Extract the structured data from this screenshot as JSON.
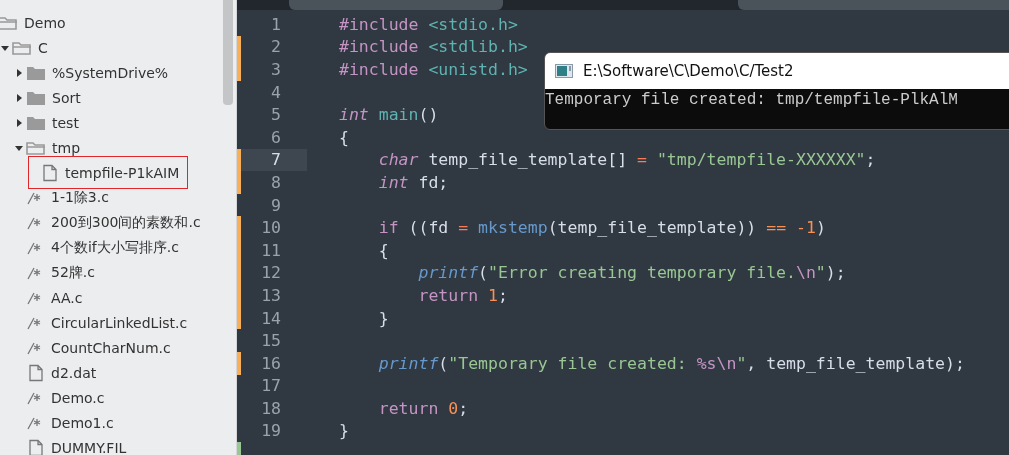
{
  "sidebar": {
    "tree": [
      {
        "name": "Demo",
        "kind": "folder",
        "expanded": true,
        "children": [
          {
            "name": "C",
            "kind": "folder",
            "expanded": true,
            "children": [
              {
                "name": "%SystemDrive%",
                "kind": "folder",
                "expanded": false
              },
              {
                "name": "Sort",
                "kind": "folder",
                "expanded": false
              },
              {
                "name": "test",
                "kind": "folder",
                "expanded": false
              },
              {
                "name": "tmp",
                "kind": "folder",
                "expanded": true,
                "children": [
                  {
                    "name": "tempfile-P1kAIM",
                    "kind": "file",
                    "highlighted": true
                  }
                ]
              },
              {
                "name": "1-1除3.c",
                "kind": "source",
                "highlighted": false
              },
              {
                "name": "200到300间的素数和.c",
                "kind": "source",
                "highlighted": false
              },
              {
                "name": "4个数if大小写排序.c",
                "kind": "source",
                "highlighted": false
              },
              {
                "name": "52牌.c",
                "kind": "source",
                "highlighted": false
              },
              {
                "name": "AA.c",
                "kind": "source",
                "highlighted": false
              },
              {
                "name": "CircularLinkedList.c",
                "kind": "source",
                "highlighted": false
              },
              {
                "name": "CountCharNum.c",
                "kind": "source",
                "highlighted": false
              },
              {
                "name": "d2.dat",
                "kind": "file",
                "highlighted": false
              },
              {
                "name": "Demo.c",
                "kind": "source",
                "highlighted": false
              },
              {
                "name": "Demo1.c",
                "kind": "source",
                "highlighted": false
              },
              {
                "name": "DUMMY.FIL",
                "kind": "file",
                "highlighted": false
              }
            ]
          }
        ]
      }
    ]
  },
  "editor": {
    "lines": [
      {
        "number": "1",
        "kind": "unchanged",
        "current": false,
        "tokens": [
          {
            "kind": "pp",
            "text": "#include"
          },
          {
            "kind": "hdr",
            "text": " <stdio.h>"
          }
        ]
      },
      {
        "number": "2",
        "kind": "modified",
        "current": false,
        "tokens": [
          {
            "kind": "pp",
            "text": "#include"
          },
          {
            "kind": "hdr",
            "text": " <stdlib.h>"
          }
        ]
      },
      {
        "number": "3",
        "kind": "modified",
        "current": false,
        "tokens": [
          {
            "kind": "pp",
            "text": "#include"
          },
          {
            "kind": "hdr",
            "text": " <unistd.h>"
          }
        ]
      },
      {
        "number": "4",
        "kind": "unchanged",
        "current": false
      },
      {
        "number": "5",
        "kind": "unchanged",
        "current": false,
        "tokens": [
          {
            "kind": "type",
            "text": "int"
          },
          {
            "kind": "main",
            "text": " main"
          },
          {
            "kind": "plain",
            "text": "()"
          }
        ]
      },
      {
        "number": "6",
        "kind": "unchanged",
        "current": false,
        "tokens": [
          {
            "kind": "plain",
            "text": "{"
          }
        ]
      },
      {
        "number": "7",
        "kind": "modified",
        "current": true,
        "tokens": [
          {
            "kind": "type",
            "text": "    char"
          },
          {
            "kind": "plain",
            "text": " temp_file_template[]"
          },
          {
            "kind": "op",
            "text": " ="
          },
          {
            "kind": "str",
            "text": " \"tmp/tempfile-XXXXXX\""
          },
          {
            "kind": "plain",
            "text": ";"
          }
        ]
      },
      {
        "number": "8",
        "kind": "modified",
        "current": false,
        "tokens": [
          {
            "kind": "type",
            "text": "    int"
          },
          {
            "kind": "plain",
            "text": " fd;"
          }
        ]
      },
      {
        "number": "9",
        "kind": "unchanged",
        "current": false
      },
      {
        "number": "10",
        "kind": "modified",
        "current": false,
        "tokens": [
          {
            "kind": "kw",
            "text": "    if"
          },
          {
            "kind": "plain",
            "text": " ((fd"
          },
          {
            "kind": "op",
            "text": " ="
          },
          {
            "kind": "fn",
            "text": " mkstemp"
          },
          {
            "kind": "plain",
            "text": "(temp_file_template))"
          },
          {
            "kind": "num",
            "text": " =="
          },
          {
            "kind": "num",
            "text": " -1"
          },
          {
            "kind": "plain",
            "text": ")"
          }
        ]
      },
      {
        "number": "11",
        "kind": "modified",
        "current": false,
        "tokens": [
          {
            "kind": "plain",
            "text": "    {"
          }
        ]
      },
      {
        "number": "12",
        "kind": "modified",
        "current": false,
        "tokens": [
          {
            "kind": "call",
            "text": "        printf"
          },
          {
            "kind": "plain",
            "text": "("
          },
          {
            "kind": "str",
            "text": "\"Error creating temporary file."
          },
          {
            "kind": "esc",
            "text": "\\n"
          },
          {
            "kind": "str",
            "text": "\""
          },
          {
            "kind": "plain",
            "text": ");"
          }
        ]
      },
      {
        "number": "13",
        "kind": "modified",
        "current": false,
        "tokens": [
          {
            "kind": "kw",
            "text": "        return"
          },
          {
            "kind": "num",
            "text": " 1"
          },
          {
            "kind": "plain",
            "text": ";"
          }
        ]
      },
      {
        "number": "14",
        "kind": "modified",
        "current": false,
        "tokens": [
          {
            "kind": "plain",
            "text": "    }"
          }
        ]
      },
      {
        "number": "15",
        "kind": "unchanged",
        "current": false
      },
      {
        "number": "16",
        "kind": "modified",
        "current": false,
        "tokens": [
          {
            "kind": "call",
            "text": "    printf"
          },
          {
            "kind": "plain",
            "text": "("
          },
          {
            "kind": "str",
            "text": "\"Temporary file created: "
          },
          {
            "kind": "esc",
            "text": "%s\\n"
          },
          {
            "kind": "str",
            "text": "\""
          },
          {
            "kind": "plain",
            "text": ", temp_file_template);"
          }
        ]
      },
      {
        "number": "17",
        "kind": "unchanged",
        "current": false
      },
      {
        "number": "18",
        "kind": "unchanged",
        "current": false,
        "tokens": [
          {
            "kind": "kw",
            "text": "    return"
          },
          {
            "kind": "num",
            "text": " 0"
          },
          {
            "kind": "plain",
            "text": ";"
          }
        ]
      },
      {
        "number": "19",
        "kind": "unchanged",
        "current": false,
        "tokens": [
          {
            "kind": "plain",
            "text": "}"
          }
        ]
      },
      {
        "kind": "added",
        "current": false
      }
    ]
  },
  "console": {
    "title": "E:\\Software\\C\\Demo\\C/Test2",
    "output": "Temporary file created: tmp/tempfile-PlkAlM"
  }
}
